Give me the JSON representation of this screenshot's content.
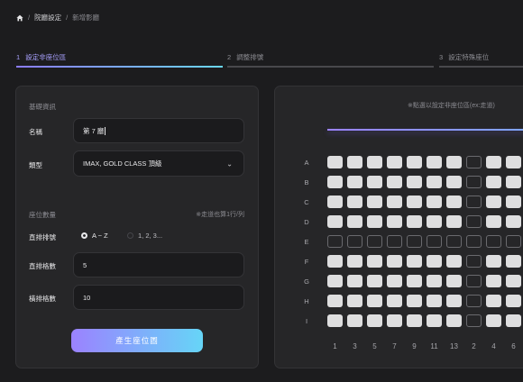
{
  "breadcrumb": {
    "home": "home",
    "sep": "/",
    "item1": "院廳設定",
    "current": "新增影廳"
  },
  "steps": [
    {
      "num": "1",
      "label": "設定非座位區"
    },
    {
      "num": "2",
      "label": "調整排號"
    },
    {
      "num": "3",
      "label": "設定特殊座位"
    }
  ],
  "form": {
    "basic_title": "基礎資訊",
    "name_label": "名稱",
    "name_value": "第 7 廳",
    "type_label": "類型",
    "type_value": "IMAX, GOLD CLASS 頂級",
    "seat_title": "座位數量",
    "seat_note": "※走道也算1行/列",
    "row_label_label": "直排排號",
    "opt_az": "A ~ Z",
    "opt_num": "1, 2, 3...",
    "rows_label": "直排格數",
    "rows_value": "5",
    "cols_label": "橫排格數",
    "cols_value": "10",
    "generate": "產生座位圖"
  },
  "map": {
    "hint": "※點選以設定非座位區(ex:走道)",
    "rows": [
      "A",
      "B",
      "C",
      "D",
      "E",
      "F",
      "G",
      "H",
      "I"
    ],
    "cols": [
      "1",
      "3",
      "5",
      "7",
      "9",
      "11",
      "13",
      "2",
      "4",
      "6"
    ],
    "aisle_row": "E",
    "aisle_col_index": 7
  },
  "colors": {
    "accent_start": "#9b82ff",
    "accent_end": "#66d5f7"
  }
}
